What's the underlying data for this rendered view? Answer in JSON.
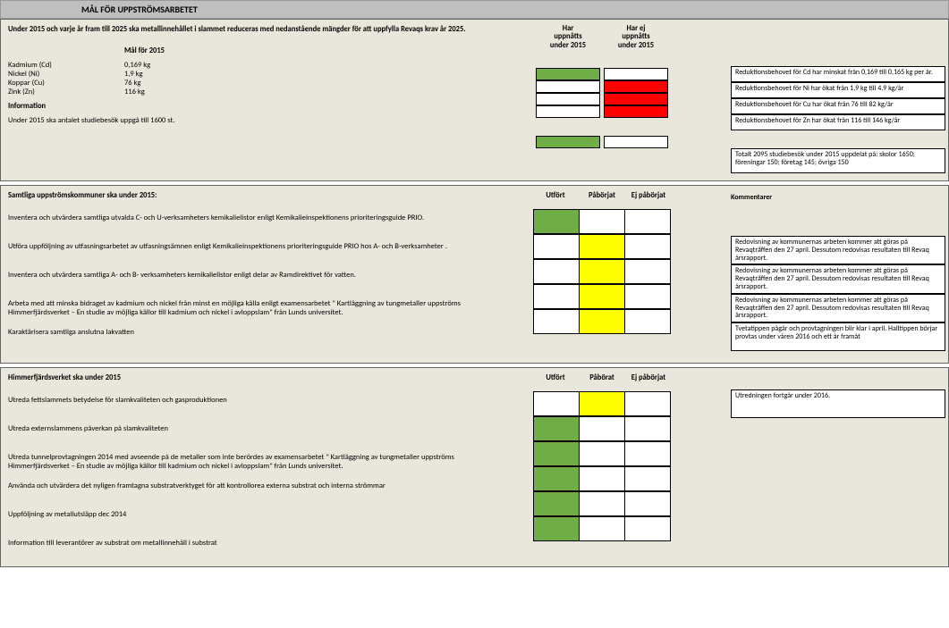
{
  "title": "MÅL FÖR UPPSTRÖMSARBETET",
  "s1": {
    "intro": "Under 2015 och varje år fram till 2025 ska metallinnehållet i slammet reduceras med nedanstående mängder för att uppfylla Revaqs krav år 2025.",
    "goals_header": "Mål för 2015",
    "status_head_a1": "Har",
    "status_head_a2": "uppnåtts",
    "status_head_a3": "under 2015",
    "status_head_b1": "Har ej",
    "status_head_b2": "uppnåtts",
    "status_head_b3": "under 2015",
    "rows": [
      {
        "name": "Kadmium (Cd)",
        "val": "0,169 kg",
        "a": "green",
        "b": "white",
        "c": "Reduktionsbehovet för Cd har minskat från 0,169 till 0,165 kg per år."
      },
      {
        "name": "Nickel (Ni)",
        "val": "1,9 kg",
        "a": "white",
        "b": "red",
        "c": "Reduktionsbehovet för Ni har ökat från 1,9 kg till 4,9 kg/år"
      },
      {
        "name": "Koppar (Cu)",
        "val": "76 kg",
        "a": "white",
        "b": "red",
        "c": "Reduktionsbehovet för Cu har ökat från 76 till 82 kg/år"
      },
      {
        "name": "Zink (Zn)",
        "val": "116 kg",
        "a": "white",
        "b": "red",
        "c": "Reduktionsbehovet för Zn har ökat från 116 till 146 kg/år"
      }
    ],
    "info_label": "Information",
    "info_text": "Under 2015 ska antalet studiebesök uppgå till 1600 st.",
    "info_a": "green",
    "info_b": "white",
    "info_comment": "Totalt 2095 studiebesök under 2015 uppdelat på: skolor 1650; föreningar 150; företag 145; övriga 150"
  },
  "s2": {
    "heading": "Samtliga uppströmskommuner ska under 2015:",
    "h1": "Utfört",
    "h2": "Påbörjat",
    "h3": "Ej påbörjat",
    "h4": "Kommentarer",
    "tasks": [
      {
        "t": "Inventera och utvärdera samtliga utvalda C- och U-verksamheters kemikalielistor enligt Kemikalieinspektionens prioriteringsguide PRIO.",
        "c1": "green",
        "c2": "white",
        "c3": "white",
        "comment": ""
      },
      {
        "t": "Utföra uppföljning av utfasningsarbetet av utfasningsämnen enligt Kemikalieinspektionens prioriteringsguide PRIO hos A- och B-verksamheter .",
        "c1": "white",
        "c2": "yellow",
        "c3": "white",
        "comment": "Redovisning av kommunernas arbeten kommer att göras på Revaqträffen den 27 april. Dessutom redovisas resultaten till Revaq årsrapport."
      },
      {
        "t": "Inventera och utvärdera samtliga A- och B- verksamheters kemikalielistor enligt delar av Ramdirektivet för vatten.",
        "c1": "white",
        "c2": "yellow",
        "c3": "white",
        "comment": "Redovisning av kommunernas arbeten kommer att göras på Revaqträffen den 27 april. Dessutom redovisas resultaten till Revaq årsrapport."
      },
      {
        "t": "Arbeta med att minska bidraget av kadmium och nickel från minst en möjliga källa enligt examensarbetet \" Kartläggning av tungmetaller uppströms Himmerfjärdsverket – En studie av möjliga källor till kadmium och nickel i avloppslam\" från Lunds universitet.",
        "c1": "white",
        "c2": "yellow",
        "c3": "white",
        "comment": "Redovisning av kommunernas arbeten kommer att göras på Revaqträffen den 27 april. Dessutom redovisas resultaten till Revaq årsrapport."
      },
      {
        "t": "Karaktärisera samtliga anslutna lakvatten",
        "c1": "white",
        "c2": "yellow",
        "c3": "white",
        "comment": "Tvetatippen pågår och provtagningen blir klar i april. Halltippen börjar provtas under våren 2016 och ett år framåt"
      }
    ]
  },
  "s3": {
    "heading": "Himmerfjärdsverket ska under 2015",
    "h1": "Utfört",
    "h2": "Påbörat",
    "h3": "Ej påbörjat",
    "tasks": [
      {
        "t": "Utreda fettslammets betydelse för slamkvaliteten och gasproduktionen",
        "c1": "white",
        "c2": "yellow",
        "c3": "white",
        "comment": "Utredningen fortgår under 2016."
      },
      {
        "t": "Utreda externslammens påverkan på slamkvaliteten",
        "c1": "green",
        "c2": "white",
        "c3": "white",
        "comment": ""
      },
      {
        "t": "Utreda tunnelprovtagningen 2014 med avseende på de metaller som inte berördes av examensarbetet \" Kartläggning av tungmetaller uppströms Himmerfjärdsverket – En studie av möjliga källor till kadmium och nickel i avloppslam\" från Lunds universitet.",
        "c1": "green",
        "c2": "white",
        "c3": "white",
        "comment": ""
      },
      {
        "t": "Använda och utvärdera det nyligen framtagna substratverktyget för att kontrollorea externa substrat och interna strömmar",
        "c1": "green",
        "c2": "white",
        "c3": "white",
        "comment": ""
      },
      {
        "t": "Uppföljning av metallutsläpp dec 2014",
        "c1": "green",
        "c2": "white",
        "c3": "white",
        "comment": ""
      },
      {
        "t": "Information till leverantörer av substrat om metallinnehåll i substrat",
        "c1": "green",
        "c2": "white",
        "c3": "white",
        "comment": ""
      }
    ]
  }
}
